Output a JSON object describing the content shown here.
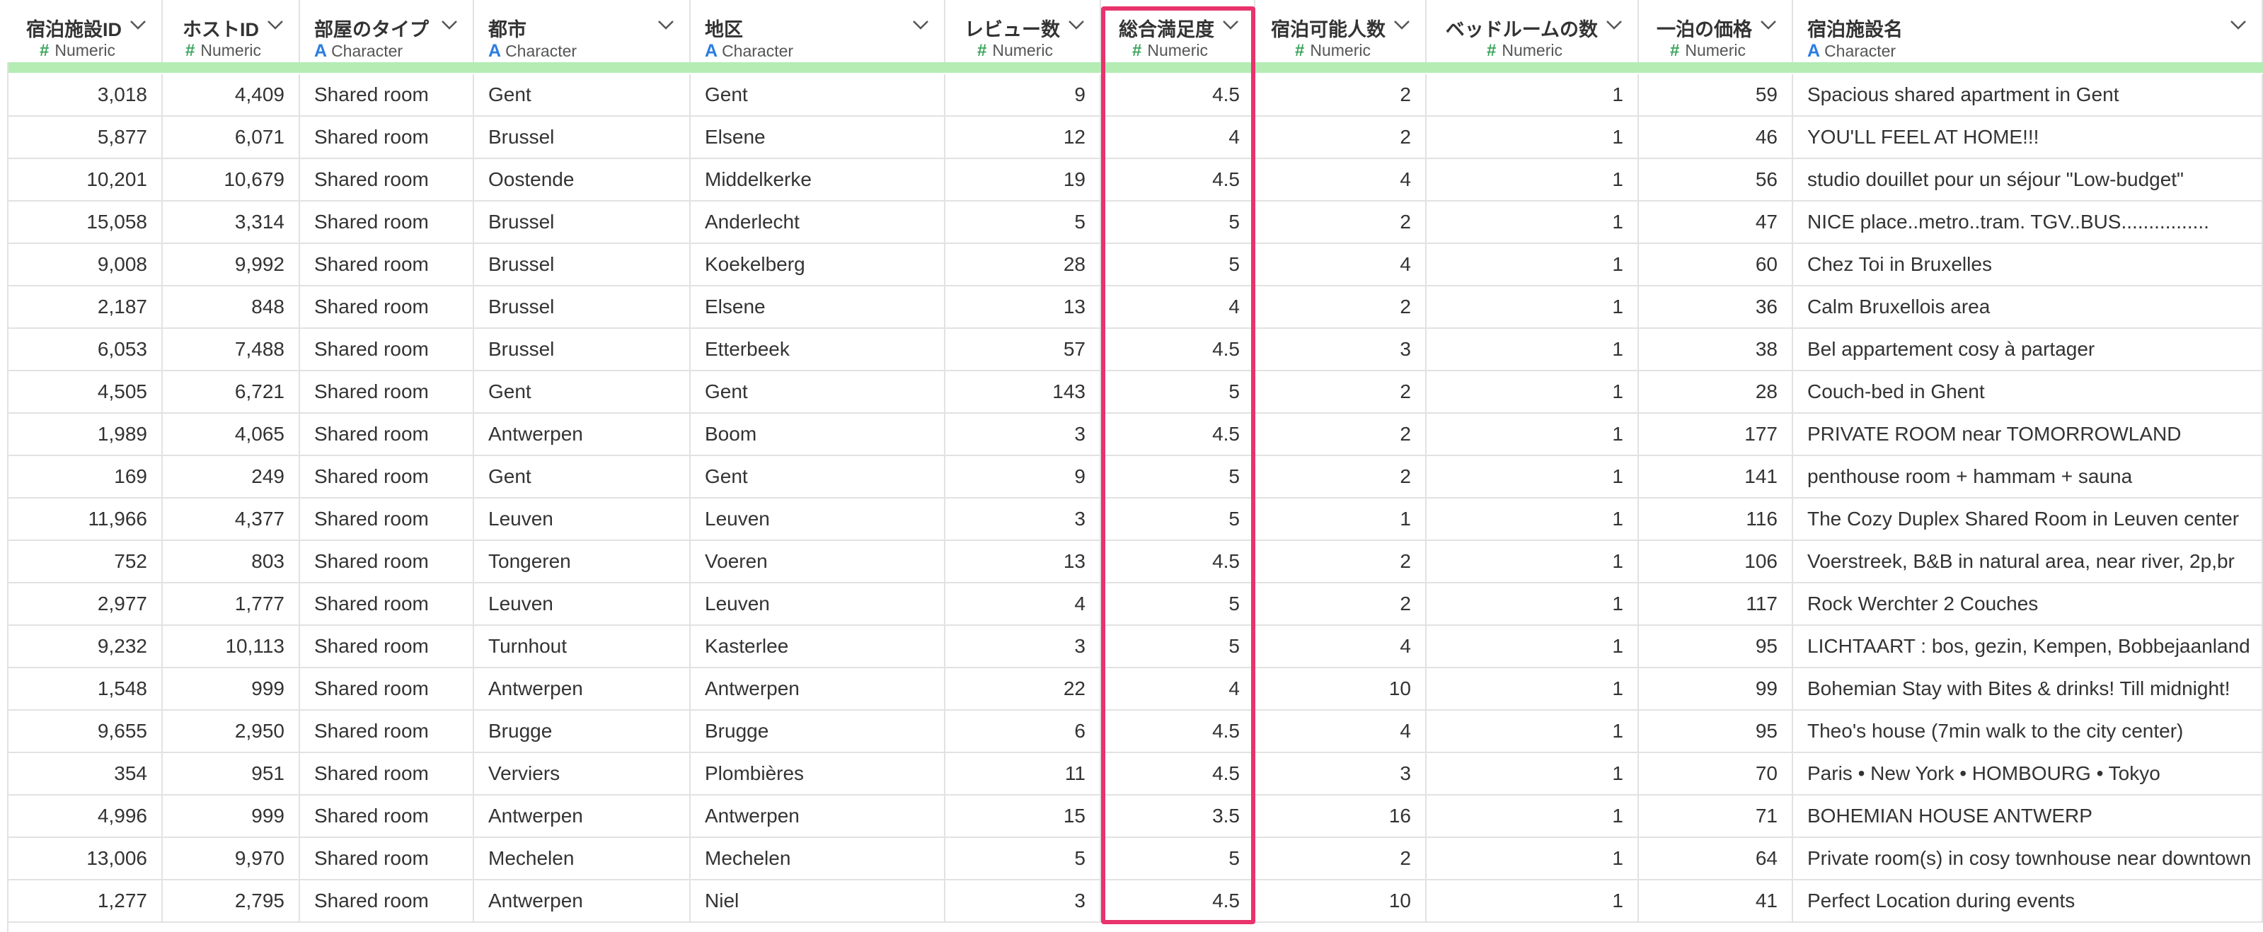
{
  "columns": [
    {
      "name": "宿泊施設ID",
      "type": "Numeric",
      "kind": "num"
    },
    {
      "name": "ホストID",
      "type": "Numeric",
      "kind": "num"
    },
    {
      "name": "部屋のタイプ",
      "type": "Character",
      "kind": "chr"
    },
    {
      "name": "都市",
      "type": "Character",
      "kind": "chr"
    },
    {
      "name": "地区",
      "type": "Character",
      "kind": "chr"
    },
    {
      "name": "レビュー数",
      "type": "Numeric",
      "kind": "num"
    },
    {
      "name": "総合満足度",
      "type": "Numeric",
      "kind": "num"
    },
    {
      "name": "宿泊可能人数",
      "type": "Numeric",
      "kind": "num"
    },
    {
      "name": "ベッドルームの数",
      "type": "Numeric",
      "kind": "num"
    },
    {
      "name": "一泊の価格",
      "type": "Numeric",
      "kind": "num"
    },
    {
      "name": "宿泊施設名",
      "type": "Character",
      "kind": "chr"
    }
  ],
  "highlighted_column": "総合満足度",
  "colors": {
    "numeric_icon": "#3ba55c",
    "character_icon": "#2a7de1",
    "highlight": "#e8336d",
    "header_strip": "#b4ecb4"
  },
  "rows": [
    [
      "3,018",
      "4,409",
      "Shared room",
      "Gent",
      "Gent",
      "9",
      "4.5",
      "2",
      "1",
      "59",
      "Spacious shared apartment in Gent"
    ],
    [
      "5,877",
      "6,071",
      "Shared room",
      "Brussel",
      "Elsene",
      "12",
      "4",
      "2",
      "1",
      "46",
      "YOU'LL FEEL AT HOME!!!"
    ],
    [
      "10,201",
      "10,679",
      "Shared room",
      "Oostende",
      "Middelkerke",
      "19",
      "4.5",
      "4",
      "1",
      "56",
      "studio douillet pour un séjour \"Low-budget\""
    ],
    [
      "15,058",
      "3,314",
      "Shared room",
      "Brussel",
      "Anderlecht",
      "5",
      "5",
      "2",
      "1",
      "47",
      "NICE place..metro..tram. TGV..BUS................"
    ],
    [
      "9,008",
      "9,992",
      "Shared room",
      "Brussel",
      "Koekelberg",
      "28",
      "5",
      "4",
      "1",
      "60",
      "Chez Toi in Bruxelles"
    ],
    [
      "2,187",
      "848",
      "Shared room",
      "Brussel",
      "Elsene",
      "13",
      "4",
      "2",
      "1",
      "36",
      "Calm Bruxellois area"
    ],
    [
      "6,053",
      "7,488",
      "Shared room",
      "Brussel",
      "Etterbeek",
      "57",
      "4.5",
      "3",
      "1",
      "38",
      "Bel appartement cosy à partager"
    ],
    [
      "4,505",
      "6,721",
      "Shared room",
      "Gent",
      "Gent",
      "143",
      "5",
      "2",
      "1",
      "28",
      "Couch-bed in Ghent"
    ],
    [
      "1,989",
      "4,065",
      "Shared room",
      "Antwerpen",
      "Boom",
      "3",
      "4.5",
      "2",
      "1",
      "177",
      "PRIVATE ROOM near TOMORROWLAND"
    ],
    [
      "169",
      "249",
      "Shared room",
      "Gent",
      "Gent",
      "9",
      "5",
      "2",
      "1",
      "141",
      "penthouse room + hammam + sauna"
    ],
    [
      "11,966",
      "4,377",
      "Shared room",
      "Leuven",
      "Leuven",
      "3",
      "5",
      "1",
      "1",
      "116",
      "The Cozy Duplex Shared Room in Leuven center"
    ],
    [
      "752",
      "803",
      "Shared room",
      "Tongeren",
      "Voeren",
      "13",
      "4.5",
      "2",
      "1",
      "106",
      "Voerstreek, B&B in natural area, near river, 2p,br"
    ],
    [
      "2,977",
      "1,777",
      "Shared room",
      "Leuven",
      "Leuven",
      "4",
      "5",
      "2",
      "1",
      "117",
      "Rock Werchter 2 Couches"
    ],
    [
      "9,232",
      "10,113",
      "Shared room",
      "Turnhout",
      "Kasterlee",
      "3",
      "5",
      "4",
      "1",
      "95",
      "LICHTAART : bos, gezin, Kempen, Bobbejaanland"
    ],
    [
      "1,548",
      "999",
      "Shared room",
      "Antwerpen",
      "Antwerpen",
      "22",
      "4",
      "10",
      "1",
      "99",
      "Bohemian Stay with Bites & drinks! Till midnight!"
    ],
    [
      "9,655",
      "2,950",
      "Shared room",
      "Brugge",
      "Brugge",
      "6",
      "4.5",
      "4",
      "1",
      "95",
      "Theo's house (7min walk to the city center)"
    ],
    [
      "354",
      "951",
      "Shared room",
      "Verviers",
      "Plombières",
      "11",
      "4.5",
      "3",
      "1",
      "70",
      "Paris • New York • HOMBOURG • Tokyo"
    ],
    [
      "4,996",
      "999",
      "Shared room",
      "Antwerpen",
      "Antwerpen",
      "15",
      "3.5",
      "16",
      "1",
      "71",
      "BOHEMIAN HOUSE ANTWERP"
    ],
    [
      "13,006",
      "9,970",
      "Shared room",
      "Mechelen",
      "Mechelen",
      "5",
      "5",
      "2",
      "1",
      "64",
      "Private room(s) in cosy townhouse near downtown"
    ],
    [
      "1,277",
      "2,795",
      "Shared room",
      "Antwerpen",
      "Niel",
      "3",
      "4.5",
      "10",
      "1",
      "41",
      "Perfect Location during events"
    ]
  ]
}
